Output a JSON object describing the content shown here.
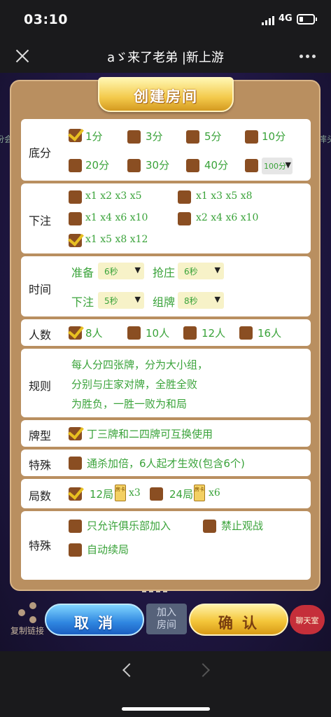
{
  "status": {
    "time": "03:10",
    "network": "4G"
  },
  "titlebar": {
    "title": "aゞ来了老弟 |新上游"
  },
  "sides": {
    "left": "份会",
    "right": "摔头"
  },
  "dialog": {
    "banner": "创建房间",
    "difen": {
      "label": "底分",
      "options": [
        "1分",
        "3分",
        "5分",
        "10分",
        "20分",
        "30分",
        "40分"
      ],
      "select": "100分"
    },
    "xiazhu": {
      "label": "下注",
      "options": [
        "x1 x2 x3 x5",
        "x1 x3 x5 x8",
        "x1 x4 x6 x10",
        "x2 x4 x6 x10",
        "x1 x5 x8 x12"
      ]
    },
    "time": {
      "label": "时间",
      "zhunbei_label": "准备",
      "zhunbei_value": "6秒",
      "qiangzhuang_label": "抢庄",
      "qiangzhuang_value": "6秒",
      "xiazhu_label": "下注",
      "xiazhu_value": "5秒",
      "zupai_label": "组牌",
      "zupai_value": "8秒"
    },
    "renshu": {
      "label": "人数",
      "options": [
        "8人",
        "10人",
        "12人",
        "16人"
      ]
    },
    "guize": {
      "label": "规则",
      "lines": [
        "每人分四张牌，分为大小组，",
        "分别与庄家对牌，全胜全败",
        "为胜负，一胜一败为和局"
      ]
    },
    "paixing": {
      "label": "牌型",
      "option": "丁三牌和二四牌可互换使用"
    },
    "teshu1": {
      "label": "特殊",
      "option": "通杀加倍，6人起才生效(包含6个)"
    },
    "jushu": {
      "label": "局数",
      "opt1": "12局",
      "opt1_mult": "x3",
      "opt2": "24局",
      "opt2_mult": "x6",
      "card_text": "房卡"
    },
    "teshu2": {
      "label": "特殊",
      "options": [
        "只允许俱乐部加入",
        "禁止观战",
        "自动续局"
      ]
    }
  },
  "footer": {
    "share": "复制链接",
    "cancel": "取 消",
    "join": "加入\n房间",
    "ok": "确 认",
    "chat": "聊天室"
  }
}
